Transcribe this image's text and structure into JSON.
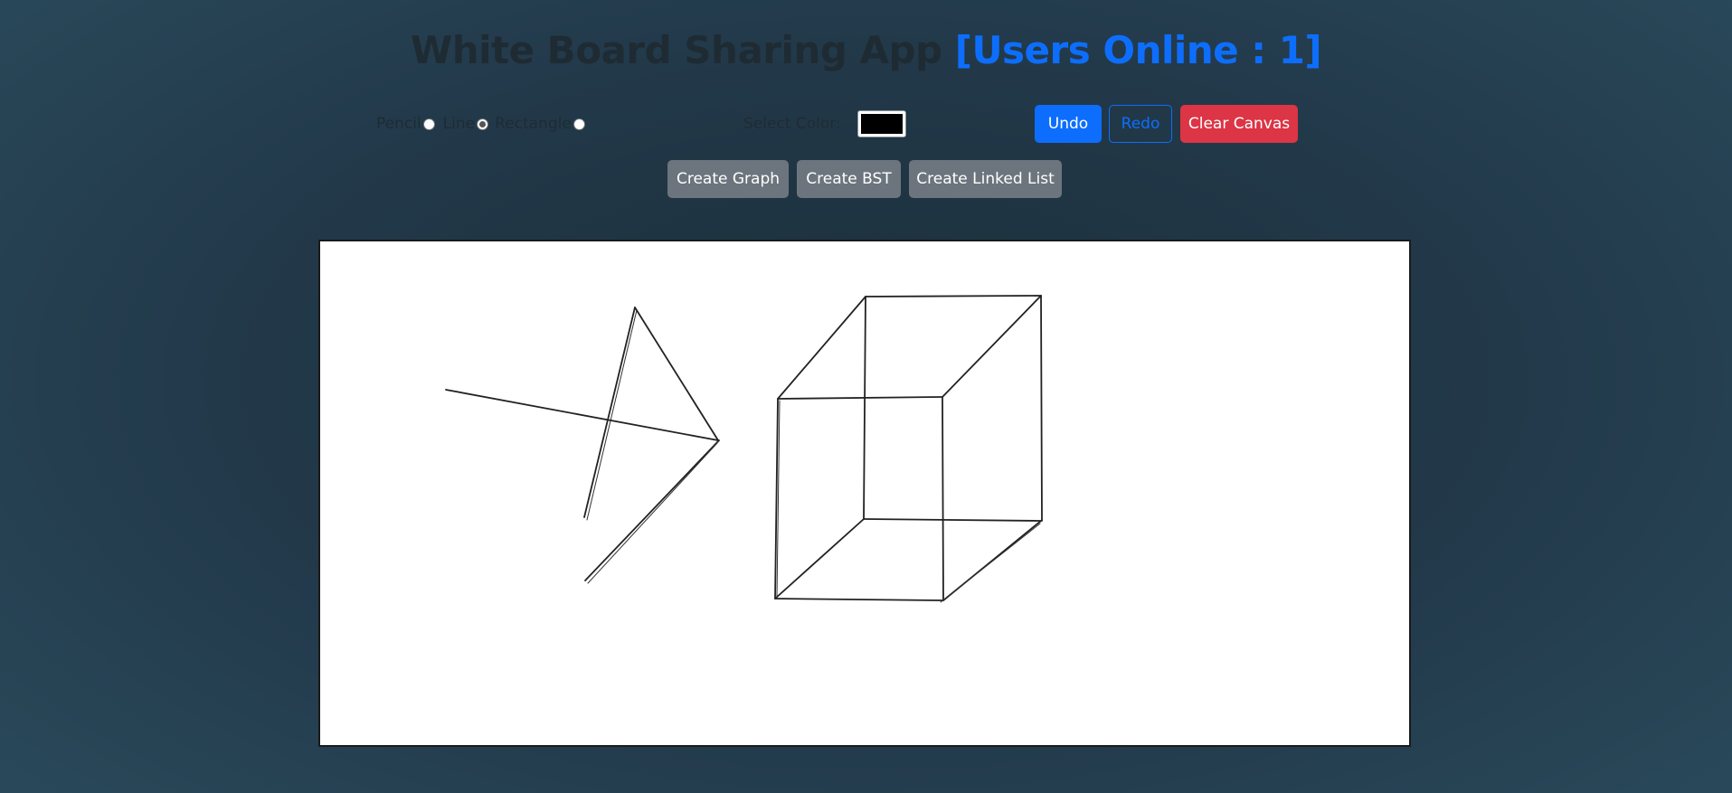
{
  "header": {
    "title": "White Board Sharing App",
    "users_online": "[Users Online : 1]"
  },
  "tools": {
    "options": [
      {
        "label": "Pencil",
        "checked": false
      },
      {
        "label": "Line",
        "checked": true
      },
      {
        "label": "Rectangle",
        "checked": false
      }
    ]
  },
  "color_picker": {
    "label": "Select Color:",
    "value": "#000000"
  },
  "actions": {
    "undo": "Undo",
    "redo": "Redo",
    "clear": "Clear Canvas"
  },
  "generators": {
    "graph": "Create Graph",
    "bst": "Create BST",
    "linked_list": "Create Linked List"
  },
  "colors": {
    "primary": "#0d6efd",
    "danger": "#dc3545",
    "secondary": "#6c757d",
    "stroke": "#000000"
  }
}
